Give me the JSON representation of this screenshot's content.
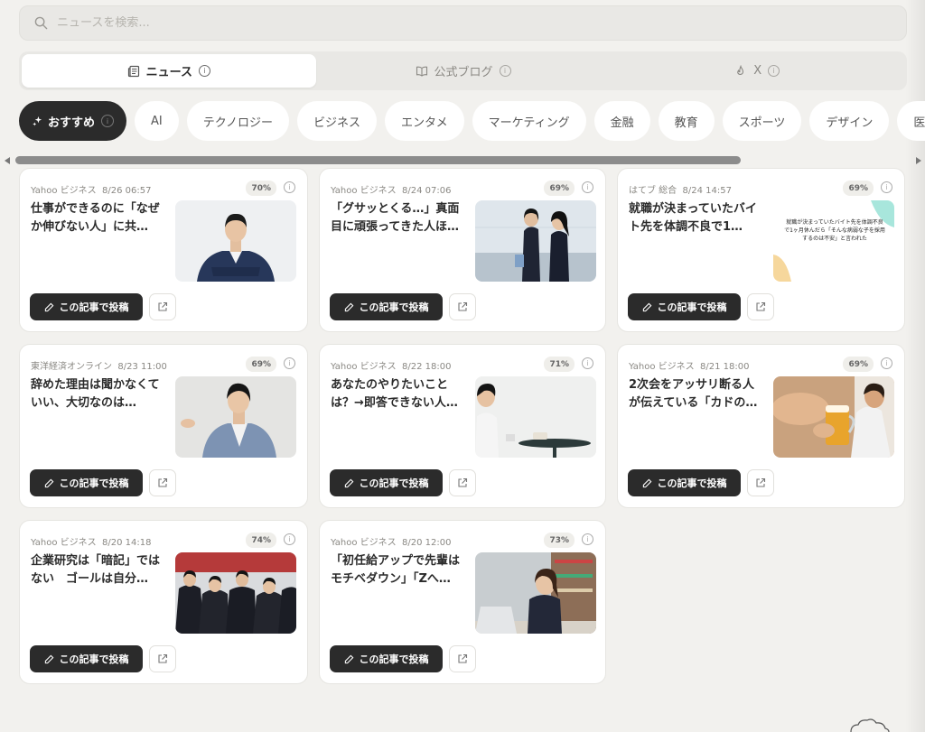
{
  "search": {
    "placeholder": "ニュースを検索..."
  },
  "source_tabs": [
    {
      "label": "ニュース",
      "icon": "newspaper-icon",
      "active": true
    },
    {
      "label": "公式ブログ",
      "icon": "book-icon",
      "active": false
    },
    {
      "label": "X",
      "icon": "flame-icon",
      "active": false
    }
  ],
  "categories": {
    "active_label": "おすすめ",
    "items": [
      "AI",
      "テクノロジー",
      "ビジネス",
      "エンタメ",
      "マーケティング",
      "金融",
      "教育",
      "スポーツ",
      "デザイン",
      "医療・美容"
    ]
  },
  "articles": [
    {
      "source": "Yahoo ビジネス",
      "date": "8/26 06:57",
      "score": "70%",
      "title": "仕事ができるのに「なぜか伸びない人」に共…",
      "thumbnail": "businessman-portrait"
    },
    {
      "source": "Yahoo ビジネス",
      "date": "8/24 07:06",
      "score": "69%",
      "title": "「グサッとくる…」真面目に頑張ってきた人ほ…",
      "thumbnail": "two-office-workers"
    },
    {
      "source": "はてブ 総合",
      "date": "8/24 14:57",
      "score": "69%",
      "title": "就職が決まっていたバイト先を体調不良で1…",
      "thumbnail": "handwritten-note"
    },
    {
      "source": "東洋経済オンライン",
      "date": "8/23 11:00",
      "score": "69%",
      "title": "辞めた理由は聞かなくていい、大切なのは…",
      "thumbnail": "speaking-man"
    },
    {
      "source": "Yahoo ビジネス",
      "date": "8/22 18:00",
      "score": "71%",
      "title": "あなたのやりたいことは？→即答できない人…",
      "thumbnail": "cafe-scene"
    },
    {
      "source": "Yahoo ビジネス",
      "date": "8/21 18:00",
      "score": "69%",
      "title": "2次会をアッサリ断る人が伝えている「カドの…",
      "thumbnail": "beer-party"
    },
    {
      "source": "Yahoo ビジネス",
      "date": "8/20 14:18",
      "score": "74%",
      "title": "企業研究は「暗記」ではない　ゴールは自分…",
      "thumbnail": "job-seekers-seated"
    },
    {
      "source": "Yahoo ビジネス",
      "date": "8/20 12:00",
      "score": "73%",
      "title": "「初任給アップで先輩はモチベダウン」「Zへ…",
      "thumbnail": "woman-at-laptop"
    }
  ],
  "card_actions": {
    "post_label": "この記事で投稿",
    "open_icon": "external-link-icon"
  },
  "thumbnail_note_text": "就職が決まっていたバイト先を体調不良で1ヶ月休んだら「そんな病弱な子を採用するのは不安」と言われた",
  "colors": {
    "background": "#f2f1ee",
    "dark": "#2b2b2b",
    "card": "#ffffff"
  }
}
